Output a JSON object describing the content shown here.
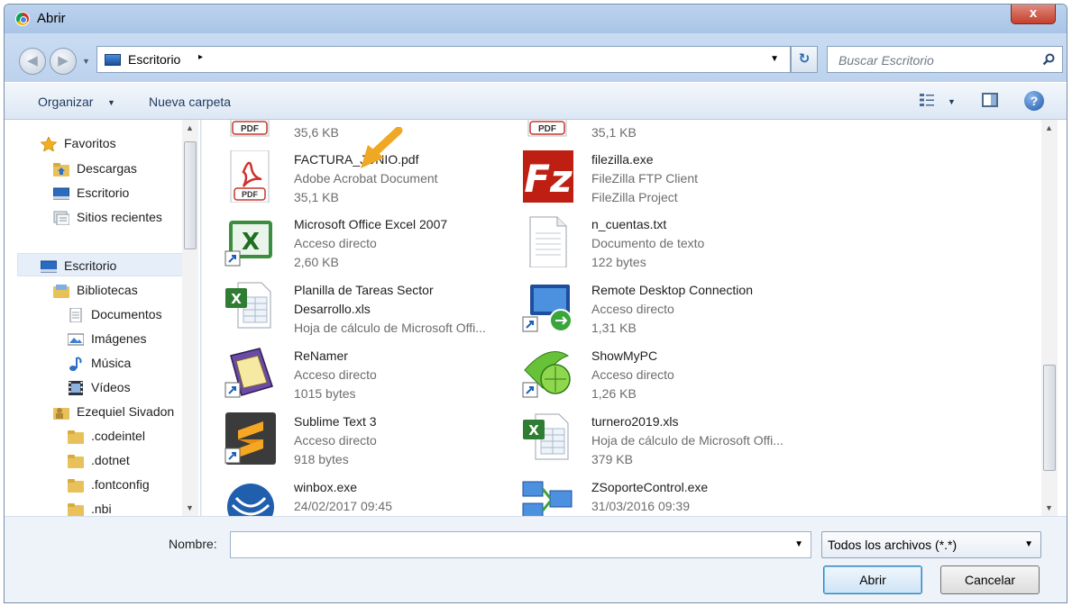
{
  "window": {
    "title": "Abrir",
    "close_label": "x"
  },
  "address": {
    "location": "Escritorio",
    "separator": "▸"
  },
  "search": {
    "placeholder": "Buscar Escritorio"
  },
  "toolbar": {
    "organize_label": "Organizar",
    "new_folder_label": "Nueva carpeta"
  },
  "sidebar": {
    "items": [
      {
        "label": "Favoritos",
        "icon": "star-icon"
      },
      {
        "label": "Descargas",
        "icon": "downloads-folder-icon"
      },
      {
        "label": "Escritorio",
        "icon": "desktop-icon"
      },
      {
        "label": "Sitios recientes",
        "icon": "recent-places-icon"
      },
      {
        "label": "Escritorio",
        "icon": "desktop-icon",
        "selected": true
      },
      {
        "label": "Bibliotecas",
        "icon": "libraries-icon"
      },
      {
        "label": "Documentos",
        "icon": "document-icon"
      },
      {
        "label": "Imágenes",
        "icon": "pictures-icon"
      },
      {
        "label": "Música",
        "icon": "music-icon"
      },
      {
        "label": "Vídeos",
        "icon": "video-icon"
      },
      {
        "label": "Ezequiel Sivadon",
        "icon": "user-folder-icon"
      },
      {
        "label": ".codeintel",
        "icon": "folder-icon"
      },
      {
        "label": ".dotnet",
        "icon": "folder-icon"
      },
      {
        "label": ".fontconfig",
        "icon": "folder-icon"
      },
      {
        "label": ".nbi",
        "icon": "folder-icon"
      }
    ]
  },
  "files": [
    {
      "lines": [
        "35,6 KB"
      ],
      "icon": "pdf-icon"
    },
    {
      "lines": [
        "35,1 KB"
      ],
      "icon": "pdf-icon"
    },
    {
      "lines": [
        "FACTURA_JUNIO.pdf",
        "Adobe Acrobat Document",
        "35,1 KB"
      ],
      "icon": "pdf-icon"
    },
    {
      "lines": [
        "filezilla.exe",
        "FileZilla FTP Client",
        "FileZilla Project"
      ],
      "icon": "filezilla-icon"
    },
    {
      "lines": [
        "Microsoft Office Excel 2007",
        "Acceso directo",
        "2,60 KB"
      ],
      "icon": "excel-shortcut-icon"
    },
    {
      "lines": [
        "n_cuentas.txt",
        "Documento de texto",
        "122 bytes"
      ],
      "icon": "text-file-icon"
    },
    {
      "lines": [
        "Planilla de Tareas Sector",
        "Desarrollo.xls",
        "Hoja de cálculo de Microsoft Offi..."
      ],
      "icon": "excel-file-icon"
    },
    {
      "lines": [
        "Remote Desktop Connection",
        "Acceso directo",
        "1,31 KB"
      ],
      "icon": "remote-desktop-icon"
    },
    {
      "lines": [
        "ReNamer",
        "Acceso directo",
        "1015 bytes"
      ],
      "icon": "renamer-icon"
    },
    {
      "lines": [
        "ShowMyPC",
        "Acceso directo",
        "1,26 KB"
      ],
      "icon": "showmypc-icon"
    },
    {
      "lines": [
        "Sublime Text 3",
        "Acceso directo",
        "918 bytes"
      ],
      "icon": "sublime-icon"
    },
    {
      "lines": [
        "turnero2019.xls",
        "Hoja de cálculo de Microsoft Offi...",
        "379 KB"
      ],
      "icon": "excel-file-icon"
    },
    {
      "lines": [
        "winbox.exe",
        "24/02/2017 09:45"
      ],
      "icon": "winbox-icon"
    },
    {
      "lines": [
        "ZSoporteControl.exe",
        "31/03/2016 09:39"
      ],
      "icon": "network-app-icon"
    }
  ],
  "footer": {
    "name_label": "Nombre:",
    "name_value": "",
    "filter_value": "Todos los archivos (*.*)",
    "open_label": "Abrir",
    "cancel_label": "Cancelar"
  },
  "colors": {
    "accent": "#3c7fb1",
    "annotation_arrow": "#f0a824"
  }
}
